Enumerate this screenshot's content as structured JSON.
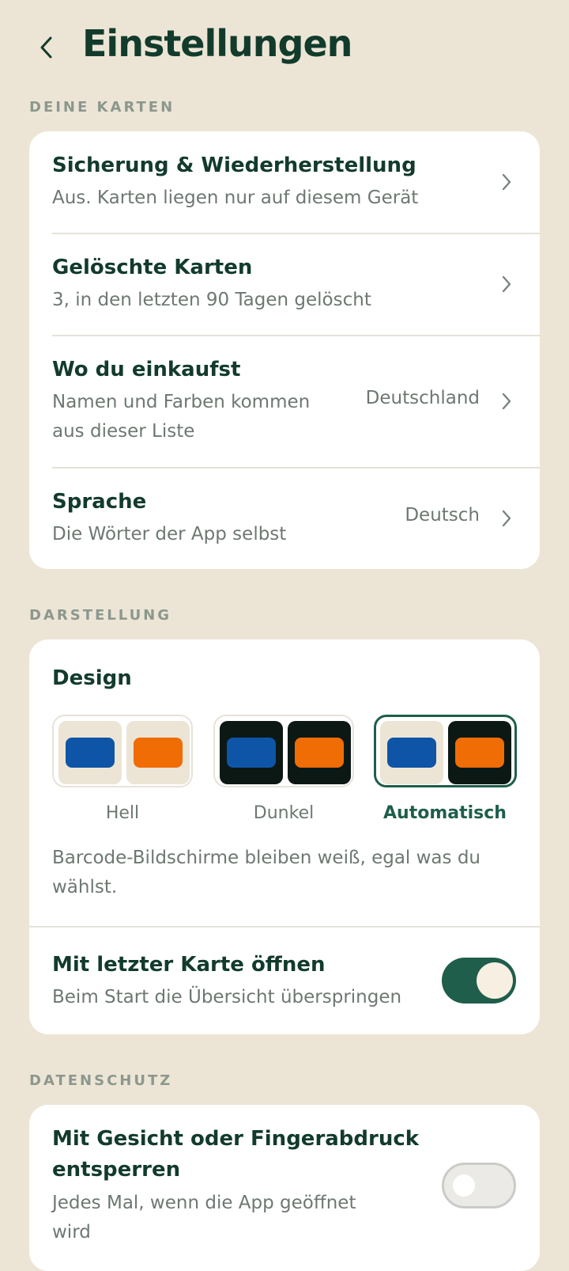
{
  "header": {
    "title": "Einstellungen"
  },
  "sections": {
    "cards": {
      "label": "DEINE KARTEN",
      "rows": [
        {
          "title": "Sicherung & Wiederherstellung",
          "subtitle": "Aus. Karten liegen nur auf diesem Gerät",
          "value": ""
        },
        {
          "title": "Gelöschte Karten",
          "subtitle": "3, in den letzten 90 Tagen gelöscht",
          "value": ""
        },
        {
          "title": "Wo du einkaufst",
          "subtitle_line1": "Namen und Farben kommen",
          "subtitle_line2": "aus dieser Liste",
          "value": "Deutschland"
        },
        {
          "title": "Sprache",
          "subtitle": "Die Wörter der App selbst",
          "value": "Deutsch"
        }
      ]
    },
    "display": {
      "label": "DARSTELLUNG",
      "design_title": "Design",
      "themes": [
        {
          "label": "Hell",
          "selected": false
        },
        {
          "label": "Dunkel",
          "selected": false
        },
        {
          "label": "Automatisch",
          "selected": true
        }
      ],
      "note_line1": "Barcode-Bildschirme bleiben weiß, egal was du",
      "note_line2": "wählst.",
      "open_last": {
        "title": "Mit letzter Karte öffnen",
        "subtitle": "Beim Start die Übersicht überspringen",
        "enabled": true
      }
    },
    "privacy": {
      "label": "DATENSCHUTZ",
      "biometric": {
        "title_line1": "Mit Gesicht oder Fingerabdruck",
        "title_line2": "entsperren",
        "subtitle_line1": "Jedes Mal, wenn die App geöffnet",
        "subtitle_line2": "wird",
        "enabled": false
      }
    }
  },
  "colors": {
    "background": "#ece5d5",
    "accent": "#1e5e4b",
    "text_dark": "#123b2c",
    "swatch_blue": "#0e55a8",
    "swatch_orange": "#f06c05",
    "dark_surface": "#0c1814",
    "light_surface": "#ece5d5"
  }
}
